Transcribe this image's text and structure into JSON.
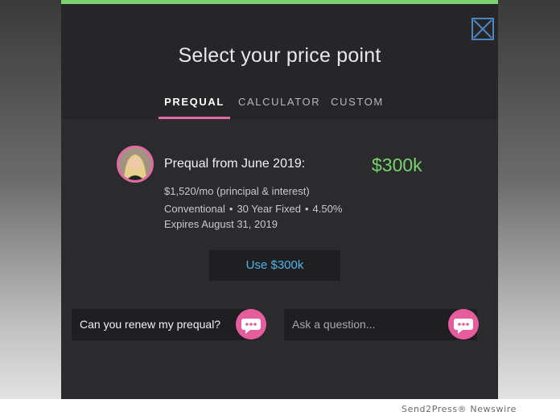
{
  "modal": {
    "title": "Select your price point",
    "close_icon": "close-icon"
  },
  "tabs": [
    {
      "label": "PREQUAL",
      "active": true
    },
    {
      "label": "CALCULATOR",
      "active": false
    },
    {
      "label": "CUSTOM",
      "active": false
    }
  ],
  "offer": {
    "title": "Prequal from June 2019:",
    "amount": "$300k",
    "monthly": "$1,520/mo (principal & interest)",
    "loan_type": "Conventional",
    "term": "30 Year Fixed",
    "rate": "4.50%",
    "expires": "Expires August 31, 2019",
    "avatar_icon": "advisor-avatar"
  },
  "actions": {
    "use_label": "Use $300k"
  },
  "chat": {
    "suggestion": "Can you renew my prequal?",
    "placeholder": "Ask a question...",
    "send_icon": "chat-bubble-icon"
  },
  "footer": {
    "watermark": "Send2Press® Newswire"
  },
  "colors": {
    "accent_pink": "#e46aa6",
    "accent_green": "#77d36d",
    "link_blue": "#4fb3e7",
    "top_bar_green": "#7bd36f"
  }
}
